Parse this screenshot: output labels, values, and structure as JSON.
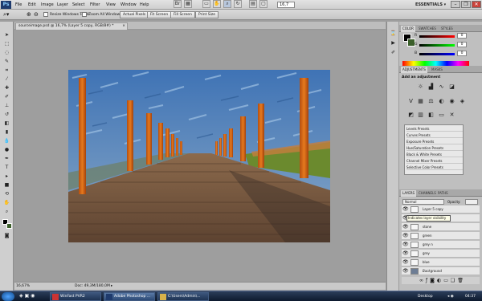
{
  "menubar": {
    "logo": "Ps",
    "items": [
      "File",
      "Edit",
      "Image",
      "Layer",
      "Select",
      "Filter",
      "View",
      "Window",
      "Help"
    ],
    "zoom": "16,7",
    "workspace": "ESSENTIALS ▾"
  },
  "options": {
    "resize_windows_label": "Resize Windows To Fit",
    "zoom_all_label": "Zoom All Windows",
    "actual_pixels": "Actual Pixels",
    "fit_screen": "Fit Screen",
    "fill_screen": "Fill Screen",
    "print_size": "Print Size"
  },
  "document": {
    "tab_title": "sourceimage.psd @ 16,7% (Layer 5 copy, RGB/8#) *",
    "zoom_status": "16,67%",
    "doc_size": "Doc: 49,3M/180,0M"
  },
  "panels": {
    "color_tabs": [
      "COLOR",
      "SWATCHES",
      "STYLES"
    ],
    "rgb": [
      {
        "letter": "R",
        "value": "0"
      },
      {
        "letter": "G",
        "value": "0"
      },
      {
        "letter": "B",
        "value": "0"
      }
    ],
    "adj_tabs": [
      "ADJUSTMENTS",
      "MASKS"
    ],
    "adj_title": "Add an adjustment",
    "presets": [
      "Levels Presets",
      "Curves Presets",
      "Exposure Presets",
      "Hue/Saturation Presets",
      "Black & White Presets",
      "Channel Mixer Presets",
      "Selective Color Presets"
    ],
    "layer_tabs": [
      "LAYERS",
      "CHANNELS",
      "PATHS"
    ],
    "blend_mode": "Normal",
    "opacity_label": "Opacity:",
    "fill_label": "Fill:",
    "lock_label": "Lock:",
    "tooltip": "Indicates layer visibility",
    "layers": [
      "Layer 5 copy",
      "",
      "stone",
      "green",
      "grey n",
      "grey",
      "blue",
      "Background"
    ]
  },
  "taskbar": {
    "items": [
      "WinFast PVR2",
      "Adobe Photoshop ...",
      "C:\\Users\\Admin\\..."
    ],
    "desktop": "Desktop",
    "clock": "04:37"
  }
}
